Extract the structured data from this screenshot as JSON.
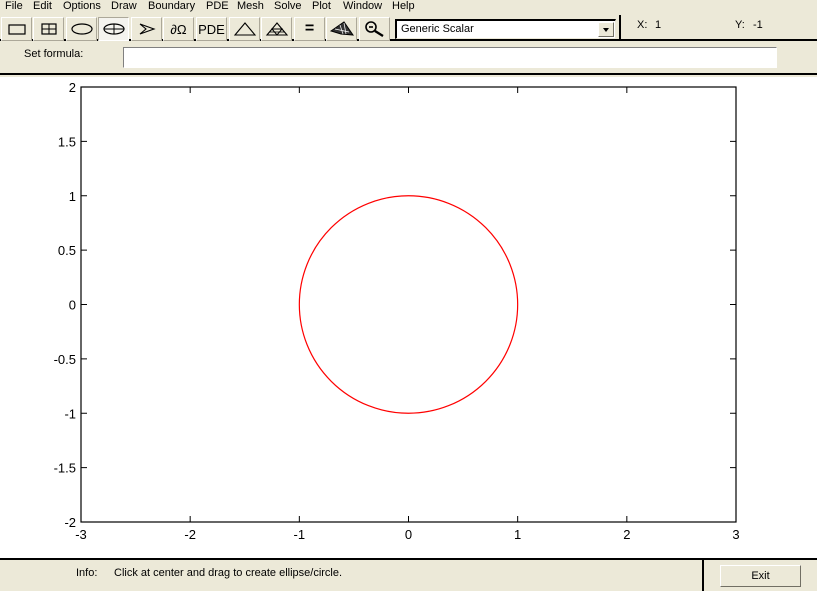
{
  "menubar": {
    "items": [
      "File",
      "Edit",
      "Options",
      "Draw",
      "Boundary",
      "PDE",
      "Mesh",
      "Solve",
      "Plot",
      "Window",
      "Help"
    ]
  },
  "toolbar": {
    "buttons": [
      {
        "name": "rectangle-square-icon",
        "tooltip": "Rectangle/square"
      },
      {
        "name": "rectangle-center-icon",
        "tooltip": "Rectangle/square (centered)"
      },
      {
        "name": "ellipse-icon",
        "tooltip": "Ellipse/circle"
      },
      {
        "name": "ellipse-center-icon",
        "tooltip": "Ellipse/circle (centered)",
        "pressed": true
      },
      {
        "name": "polygon-icon",
        "tooltip": "Polygon"
      },
      {
        "name": "boundary-icon",
        "label": "∂Ω"
      },
      {
        "name": "pde-icon",
        "label": "PDE"
      },
      {
        "name": "mesh-triangle-icon"
      },
      {
        "name": "refine-mesh-icon"
      },
      {
        "name": "solve-icon",
        "label": "="
      },
      {
        "name": "plot-icon"
      },
      {
        "name": "zoom-icon"
      }
    ],
    "app_mode": {
      "selected": "Generic Scalar"
    },
    "coords": {
      "x_label": "X:",
      "x_value": "1",
      "y_label": "Y:",
      "y_value": "-1"
    }
  },
  "formula": {
    "label": "Set formula:",
    "value": ""
  },
  "status": {
    "info_label": "Info:",
    "info_text": "Click at center and drag to create ellipse/circle.",
    "exit_label": "Exit"
  },
  "colors": {
    "shape_stroke": "#ff0000",
    "axis": "#000000",
    "panel_bg": "#ece9d8"
  },
  "chart_data": {
    "type": "line",
    "title": "",
    "xlabel": "",
    "ylabel": "",
    "xlim": [
      -3,
      3
    ],
    "ylim": [
      -2,
      2
    ],
    "grid": false,
    "x_ticks": [
      -3,
      -2,
      -1,
      0,
      1,
      2,
      3
    ],
    "x_tick_labels": [
      "-3",
      "-2",
      "-1",
      "0",
      "1",
      "2",
      "3"
    ],
    "y_ticks": [
      -2,
      -1.5,
      -1,
      -0.5,
      0,
      0.5,
      1,
      1.5,
      2
    ],
    "y_tick_labels": [
      "-2",
      "-1.5",
      "-1",
      "-0.5",
      "0",
      "0.5",
      "1",
      "1.5",
      "2"
    ],
    "shapes": [
      {
        "type": "circle",
        "center": [
          0,
          0
        ],
        "radius": 1,
        "color": "#ff0000"
      }
    ]
  }
}
